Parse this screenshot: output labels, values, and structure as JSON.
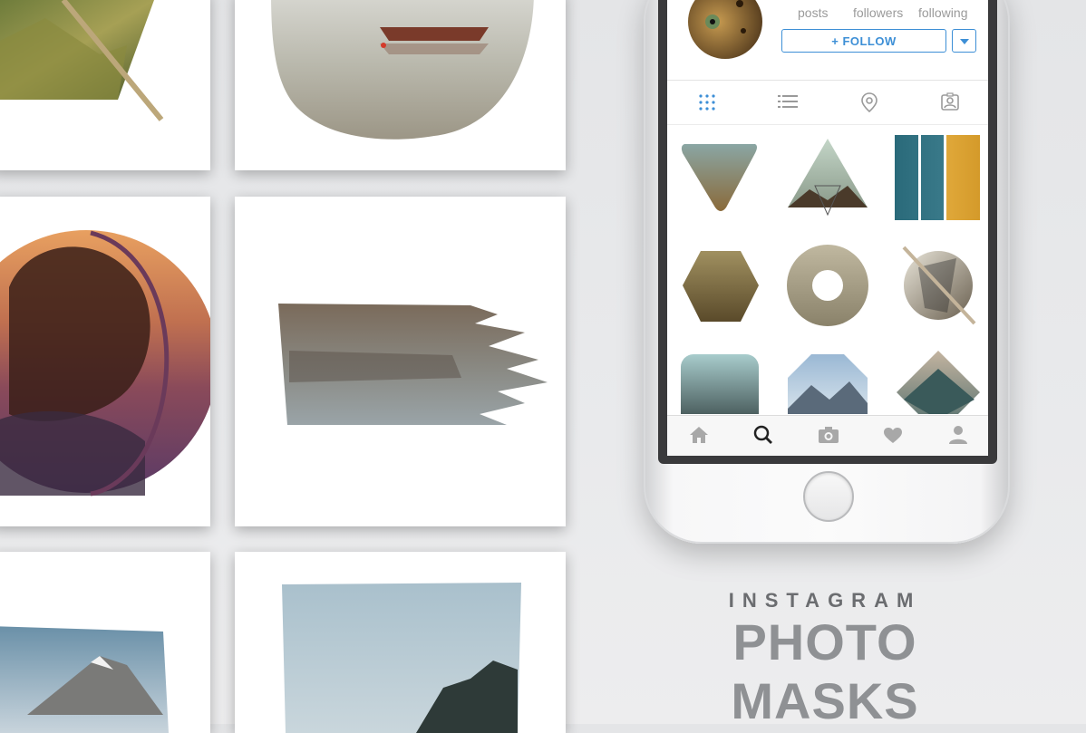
{
  "profile": {
    "stats": [
      "posts",
      "followers",
      "following"
    ],
    "follow_label": "+ FOLLOW"
  },
  "tabs": [
    "grid-icon",
    "list-icon",
    "location-pin-icon",
    "tagged-user-icon"
  ],
  "bottom_nav": [
    "home-icon",
    "search-icon",
    "camera-icon",
    "heart-icon",
    "profile-icon"
  ],
  "title": {
    "line1": "INSTAGRAM",
    "line2": "PHOTO MASKS"
  },
  "colors": {
    "accent": "#3d8fd6",
    "title_dark": "#6b6d70",
    "title_light": "#8f9194"
  }
}
